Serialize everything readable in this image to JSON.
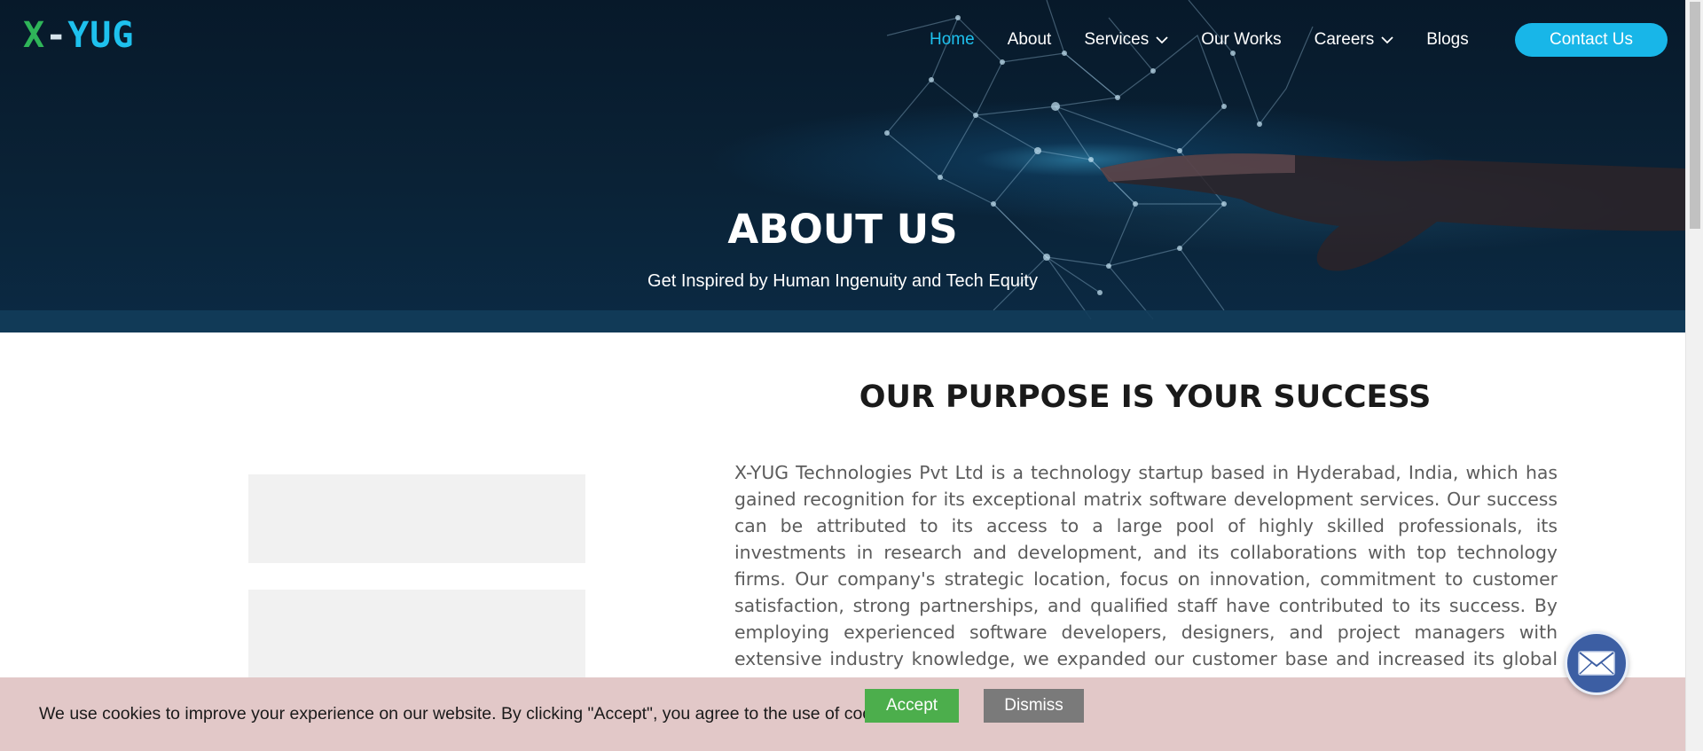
{
  "logo": {
    "x": "X",
    "dash": "-",
    "rest": "YUG"
  },
  "nav": {
    "items": [
      {
        "label": "Home",
        "active": true,
        "dropdown": false
      },
      {
        "label": "About",
        "active": false,
        "dropdown": false
      },
      {
        "label": "Services",
        "active": false,
        "dropdown": true
      },
      {
        "label": "Our Works",
        "active": false,
        "dropdown": false
      },
      {
        "label": "Careers",
        "active": false,
        "dropdown": true
      },
      {
        "label": "Blogs",
        "active": false,
        "dropdown": false
      }
    ],
    "contact_label": "Contact Us"
  },
  "hero": {
    "title": "ABOUT US",
    "subtitle": "Get Inspired by Human Ingenuity and Tech Equity"
  },
  "purpose": {
    "title": "OUR PURPOSE IS YOUR SUCCESS",
    "body": "X-YUG Technologies Pvt Ltd is a technology startup based in Hyderabad, India, which has gained recognition for its exceptional matrix software development services. Our success can be attributed to its access to a large pool of highly skilled professionals, its investments in research and development, and its collaborations with top technology firms. Our company's strategic location, focus on innovation, commitment to customer satisfaction, strong partnerships, and qualified staff have contributed to its success. By employing experienced software developers, designers, and project managers with extensive industry knowledge, we expanded our customer base and increased its global presence. Furthermore, we have invested in the professional development of"
  },
  "cookie": {
    "text": "We use cookies to improve your experience on our website. By clicking \"Accept\", you agree to the use of cookies.",
    "accept_label": "Accept",
    "dismiss_label": "Dismiss"
  },
  "icons": {
    "mail": "mail-icon",
    "chevron": "chevron-down-icon"
  },
  "colors": {
    "accent": "#1ec1ee",
    "accept": "#4cae4c",
    "dismiss": "#7a7a7a",
    "cookie_bg": "#e2c8c8",
    "mail_fab": "#3c5ea3",
    "logo_green": "#2fb559"
  }
}
